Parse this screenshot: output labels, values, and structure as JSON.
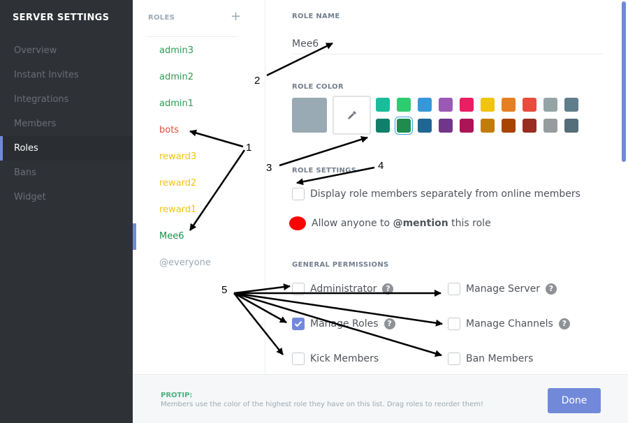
{
  "sidebar": {
    "title": "SERVER SETTINGS",
    "items": [
      {
        "label": "Overview"
      },
      {
        "label": "Instant Invites"
      },
      {
        "label": "Integrations"
      },
      {
        "label": "Members"
      },
      {
        "label": "Roles",
        "active": true
      },
      {
        "label": "Bans"
      },
      {
        "label": "Widget"
      }
    ]
  },
  "roles": {
    "header": "ROLES",
    "add_label": "+",
    "items": [
      {
        "label": "admin3",
        "color": "#2f9a53"
      },
      {
        "label": "admin2",
        "color": "#2f9a53"
      },
      {
        "label": "admin1",
        "color": "#2f9a53"
      },
      {
        "label": "bots",
        "color": "#e74c3c"
      },
      {
        "label": "reward3",
        "color": "#f1c40f"
      },
      {
        "label": "reward2",
        "color": "#f1c40f"
      },
      {
        "label": "reward1",
        "color": "#f1c40f"
      },
      {
        "label": "Mee6",
        "color": "#1f8b4c",
        "selected": true
      },
      {
        "label": "@everyone",
        "color": "#99aab5"
      }
    ]
  },
  "editor": {
    "role_name_label": "ROLE NAME",
    "role_name_value": "Mee6",
    "role_color_label": "ROLE COLOR",
    "current_color": "#99aab5",
    "swatches_row1": [
      "#1abc9c",
      "#2ecc71",
      "#3498db",
      "#9b59b6",
      "#e91e63",
      "#f1c40f",
      "#e67e22",
      "#e74c3c",
      "#95a5a6",
      "#607d8b"
    ],
    "swatches_row2": [
      "#11806a",
      "#1f8b4c",
      "#206694",
      "#71368a",
      "#ad1457",
      "#c27c0e",
      "#a84300",
      "#992d22",
      "#979c9f",
      "#546e7a"
    ],
    "selected_swatch": "#1f8b4c",
    "role_settings_label": "ROLE SETTINGS",
    "display_separately_label": "Display role members separately from online members",
    "mention_prefix": "Allow anyone to ",
    "mention_bold": "@mention",
    "mention_suffix": " this role",
    "general_permissions_label": "GENERAL PERMISSIONS",
    "permissions": {
      "administrator": {
        "label": "Administrator",
        "checked": false
      },
      "manage_server": {
        "label": "Manage Server",
        "checked": false
      },
      "manage_roles": {
        "label": "Manage Roles",
        "checked": true
      },
      "manage_channels": {
        "label": "Manage Channels",
        "checked": false
      },
      "kick_members": {
        "label": "Kick Members",
        "checked": false
      },
      "ban_members": {
        "label": "Ban Members",
        "checked": false
      }
    },
    "help_glyph": "?"
  },
  "footer": {
    "protip_title": "PROTIP:",
    "protip_text": "Members use the color of the highest role they have on this list. Drag roles to reorder them!",
    "done_label": "Done"
  },
  "annotations": [
    "1",
    "2",
    "3",
    "4",
    "5"
  ]
}
